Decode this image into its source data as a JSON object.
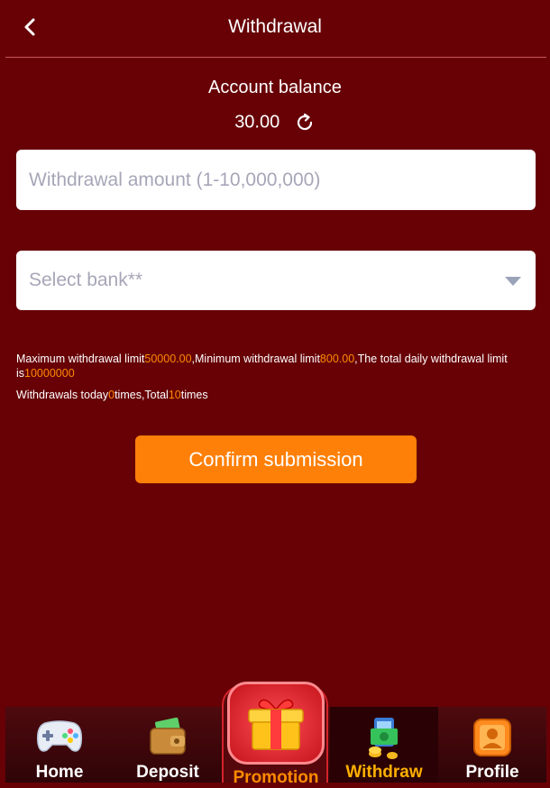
{
  "header": {
    "title": "Withdrawal"
  },
  "balance": {
    "label": "Account balance",
    "value": "30.00"
  },
  "form": {
    "amount_placeholder": "Withdrawal amount (1-10,000,000)",
    "bank_placeholder": "Select bank**",
    "submit_label": "Confirm submission"
  },
  "limits": {
    "max_prefix": "Maximum withdrawal limit",
    "max_value": "50000.00",
    "min_prefix": ",Minimum withdrawal limit",
    "min_value": "800.00",
    "daily_prefix": ",The total daily withdrawal limit is",
    "daily_value": "10000000",
    "today_prefix": "Withdrawals today",
    "today_value": "0",
    "times_total": "times,Total",
    "total_value": "10",
    "times_suffix": "times"
  },
  "nav": {
    "items": [
      {
        "label": "Home",
        "icon": "gamepad-icon"
      },
      {
        "label": "Deposit",
        "icon": "wallet-icon"
      },
      {
        "label": "Promotion",
        "icon": "gift-icon"
      },
      {
        "label": "Withdraw",
        "icon": "money-phone-icon"
      },
      {
        "label": "Profile",
        "icon": "profile-icon"
      }
    ],
    "active_index": 3,
    "active_color": "#ffb000"
  },
  "colors": {
    "background": "#670106",
    "accent": "#fe8008",
    "highlight": "#ff8a00"
  }
}
